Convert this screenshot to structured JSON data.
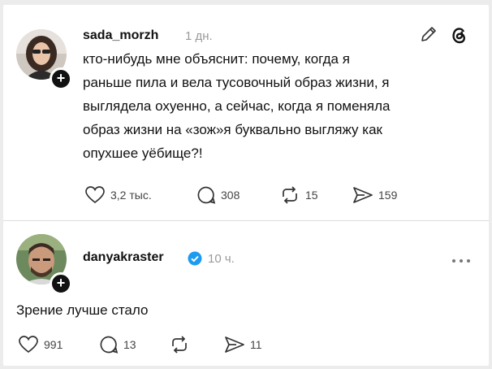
{
  "post1": {
    "username": "sada_morzh",
    "time": "1 дн.",
    "text": "кто-нибудь мне объяснит: почему, когда я\nраньше пила и вела тусовочный образ жизни, я\nвыглядела охуенно, а сейчас, когда я поменяла\nобраз жизни на «зож»я буквально выгляжу как\nопухшее уёбище?!",
    "likes": "3,2 тыс.",
    "comments": "308",
    "reposts": "15",
    "shares": "159"
  },
  "post2": {
    "username": "danyakraster",
    "time": "10 ч.",
    "text": "Зрение лучше стало",
    "likes": "991",
    "comments": "13",
    "reposts": "",
    "shares": "11",
    "verified_color": "#1d9bf0"
  },
  "icons": [
    "heart-icon",
    "comment-icon",
    "repost-icon",
    "share-icon",
    "edit-icon",
    "threads-icon",
    "more-icon",
    "verified-icon"
  ]
}
